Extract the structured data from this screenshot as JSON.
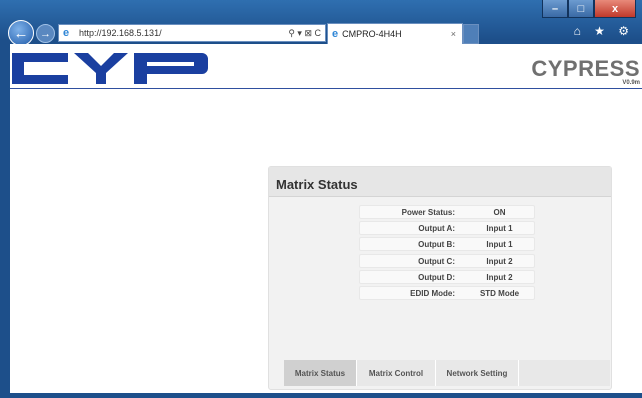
{
  "browser": {
    "url": "http://192.168.5.131/",
    "tab_title": "CMPRO-4H4H",
    "tab_close": "×",
    "addr_tools": "⚲ ▾ ⊠ C",
    "right_tools": "⌂ ★ ⚙",
    "win_min": "–",
    "win_max": "□",
    "win_close": "x"
  },
  "header": {
    "brand": "CYPRESS",
    "version": "V0.9m"
  },
  "panel": {
    "title": "Matrix Status",
    "rows": [
      {
        "label": "Power Status:",
        "value": "ON"
      },
      {
        "label": "Output A:",
        "value": "Input 1"
      },
      {
        "label": "Output B:",
        "value": "Input 1"
      },
      {
        "label": "Output C:",
        "value": "Input 2"
      },
      {
        "label": "Output D:",
        "value": "Input 2"
      },
      {
        "label": "EDID Mode:",
        "value": "STD Mode"
      }
    ],
    "tabs": [
      "Matrix Status",
      "Matrix Control",
      "Network Setting"
    ]
  },
  "colors": {
    "logo_blue": "#1a3fa0",
    "accent": "#2f4f9f"
  }
}
